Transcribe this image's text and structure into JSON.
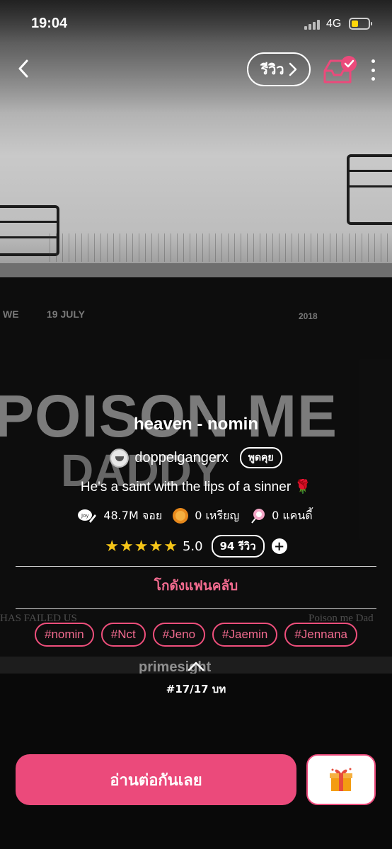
{
  "status_bar": {
    "time": "19:04",
    "network": "4G",
    "battery_level": 0.4
  },
  "nav": {
    "review_label": "รีวิว"
  },
  "background": {
    "line_left": "WE",
    "date": "19 JULY",
    "year": "2018",
    "headline": "POISON ME",
    "subline": "DADDY",
    "lower_left": "HAS FAILED US",
    "lower_right": "Poison me Dad",
    "brand": "primesight"
  },
  "story": {
    "title": "heaven - nomin",
    "author": "doppelgangerx",
    "talk_label": "พูดคุย",
    "tagline": "He's a saint with the lips of a sinner 🌹",
    "views": "48.7M จอย",
    "coins": "0 เหรียญ",
    "candy": "0 แคนดี้",
    "stars": "★★★★★",
    "rating": "5.0",
    "review_count": "94 รีวิว",
    "plus": "+",
    "fanclub": "โกดังแฟนคลับ",
    "tags": [
      "#nomin",
      "#Nct",
      "#Jeno",
      "#Jaemin",
      "#Jennana"
    ],
    "chapter": "#17/17 บท"
  },
  "actions": {
    "read_label": "อ่านต่อกันเลย"
  },
  "colors": {
    "accent": "#eb4a7b",
    "tag_text": "#f26b8f",
    "star": "#f5c518"
  }
}
